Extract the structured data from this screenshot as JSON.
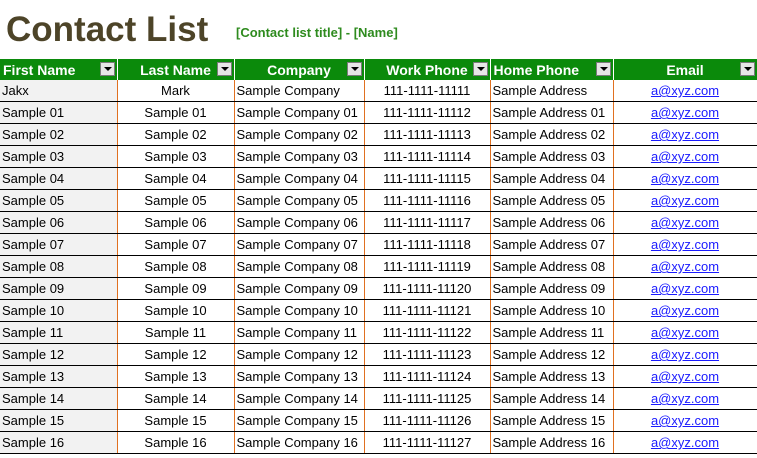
{
  "header": {
    "title": "Contact List",
    "subtitle": "[Contact list title] - [Name]"
  },
  "colors": {
    "header_bg": "#0b8a0b",
    "title_color": "#4d4428",
    "subtitle_color": "#2e8b1e",
    "grid_border": "#e07020",
    "link_color": "#1a1aff"
  },
  "table": {
    "columns": [
      "First Name",
      "Last Name",
      "Company",
      "Work Phone",
      "Home Phone",
      "Email"
    ],
    "filter_icon": "dropdown-filter-icon",
    "rows": [
      [
        "Jakx",
        "Mark",
        "Sample Company",
        "111-1111-11111",
        "Sample Address",
        "a@xyz.com"
      ],
      [
        "Sample 01",
        "Sample 01",
        "Sample Company 01",
        "111-1111-11112",
        "Sample Address 01",
        "a@xyz.com"
      ],
      [
        "Sample 02",
        "Sample 02",
        "Sample Company 02",
        "111-1111-11113",
        "Sample Address 02",
        "a@xyz.com"
      ],
      [
        "Sample 03",
        "Sample 03",
        "Sample Company 03",
        "111-1111-11114",
        "Sample Address 03",
        "a@xyz.com"
      ],
      [
        "Sample 04",
        "Sample 04",
        "Sample Company 04",
        "111-1111-11115",
        "Sample Address 04",
        "a@xyz.com"
      ],
      [
        "Sample 05",
        "Sample 05",
        "Sample Company 05",
        "111-1111-11116",
        "Sample Address 05",
        "a@xyz.com"
      ],
      [
        "Sample 06",
        "Sample 06",
        "Sample Company 06",
        "111-1111-11117",
        "Sample Address 06",
        "a@xyz.com"
      ],
      [
        "Sample 07",
        "Sample 07",
        "Sample Company 07",
        "111-1111-11118",
        "Sample Address 07",
        "a@xyz.com"
      ],
      [
        "Sample 08",
        "Sample 08",
        "Sample Company 08",
        "111-1111-11119",
        "Sample Address 08",
        "a@xyz.com"
      ],
      [
        "Sample 09",
        "Sample 09",
        "Sample Company 09",
        "111-1111-11120",
        "Sample Address 09",
        "a@xyz.com"
      ],
      [
        "Sample 10",
        "Sample 10",
        "Sample Company 10",
        "111-1111-11121",
        "Sample Address 10",
        "a@xyz.com"
      ],
      [
        "Sample 11",
        "Sample 11",
        "Sample Company 11",
        "111-1111-11122",
        "Sample Address 11",
        "a@xyz.com"
      ],
      [
        "Sample 12",
        "Sample 12",
        "Sample Company 12",
        "111-1111-11123",
        "Sample Address 12",
        "a@xyz.com"
      ],
      [
        "Sample 13",
        "Sample 13",
        "Sample Company 13",
        "111-1111-11124",
        "Sample Address 13",
        "a@xyz.com"
      ],
      [
        "Sample 14",
        "Sample 14",
        "Sample Company 14",
        "111-1111-11125",
        "Sample Address 14",
        "a@xyz.com"
      ],
      [
        "Sample 15",
        "Sample 15",
        "Sample Company 15",
        "111-1111-11126",
        "Sample Address 15",
        "a@xyz.com"
      ],
      [
        "Sample 16",
        "Sample 16",
        "Sample Company 16",
        "111-1111-11127",
        "Sample Address 16",
        "a@xyz.com"
      ]
    ]
  }
}
